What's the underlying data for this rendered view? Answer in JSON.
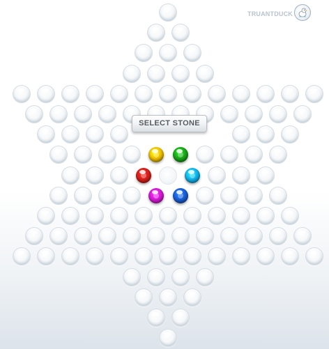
{
  "branding": {
    "name": "TRUANTDUCK",
    "logo_icon": "duck-logo-icon"
  },
  "controls": {
    "select_button_label": "SELECT STONE"
  },
  "board": {
    "type": "star",
    "hole_color": "#eef2f5",
    "stone_palette": [
      {
        "name": "yellow",
        "color": "#f2c200"
      },
      {
        "name": "green",
        "color": "#1aa81a"
      },
      {
        "name": "red",
        "color": "#d8201a"
      },
      {
        "name": "cyan",
        "color": "#12b4ee"
      },
      {
        "name": "magenta",
        "color": "#d81ad8"
      },
      {
        "name": "blue",
        "color": "#1a5fd8"
      }
    ]
  }
}
